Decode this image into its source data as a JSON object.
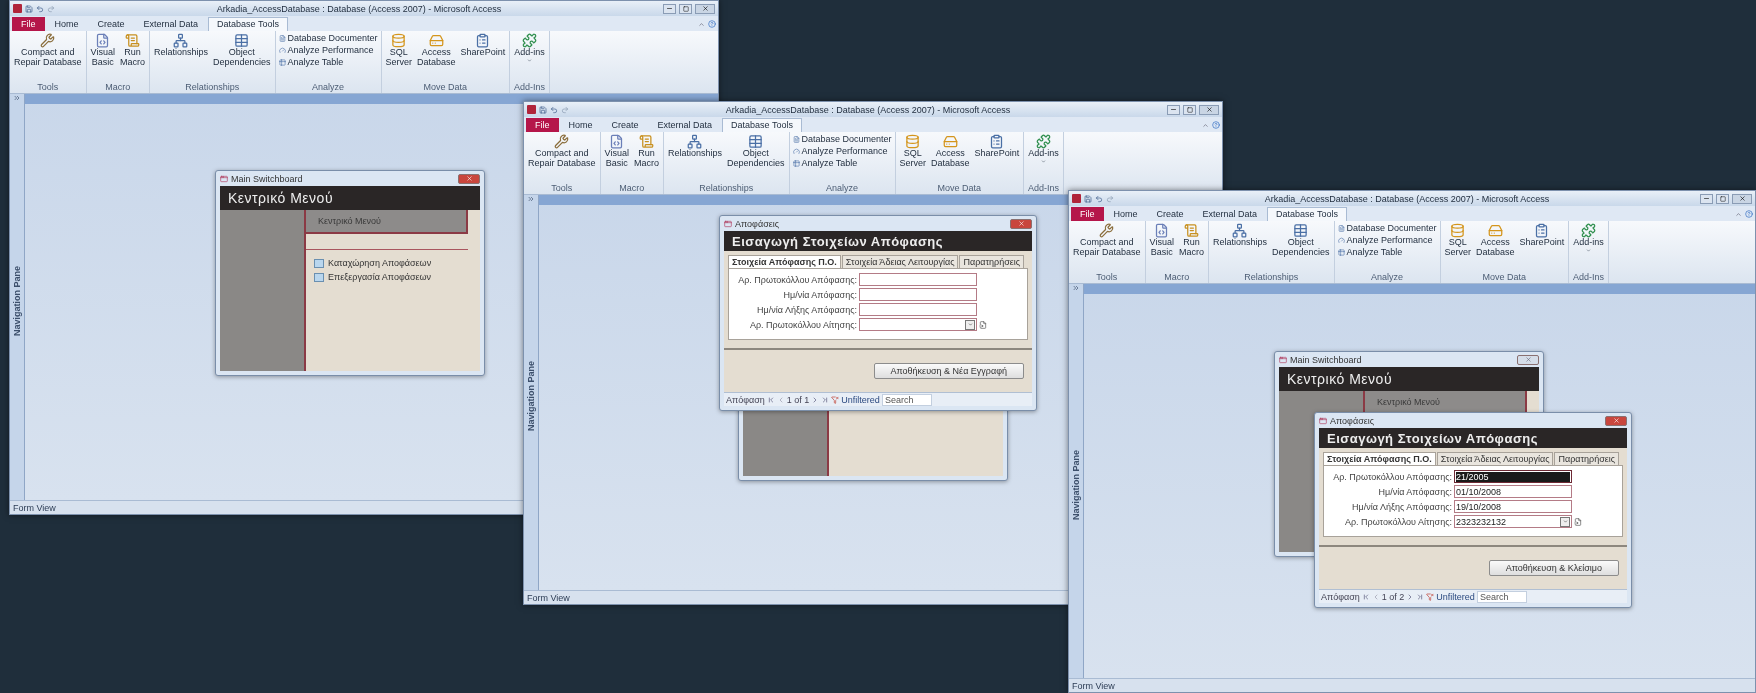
{
  "windows": [
    {
      "title": "Arkadia_AccessDatabase : Database (Access 2007) - Microsoft Access",
      "tabs": [
        {
          "label": "File",
          "kind": "backstage",
          "selected": false
        },
        {
          "label": "Home",
          "kind": "tab",
          "selected": false
        },
        {
          "label": "Create",
          "kind": "tab",
          "selected": false
        },
        {
          "label": "External Data",
          "kind": "tab",
          "selected": false
        },
        {
          "label": "Database Tools",
          "kind": "tab",
          "selected": true
        }
      ],
      "ribbon": [
        {
          "label": "Tools",
          "items": [
            {
              "label": "Compact and\nRepair Database",
              "kind": "large"
            }
          ]
        },
        {
          "label": "Macro",
          "items": [
            {
              "label": "Visual\nBasic",
              "kind": "large"
            },
            {
              "label": "Run\nMacro",
              "kind": "large"
            }
          ]
        },
        {
          "label": "Relationships",
          "items": [
            {
              "label": "Relationships",
              "kind": "large"
            },
            {
              "label": "Object\nDependencies",
              "kind": "large"
            }
          ]
        },
        {
          "label": "Analyze",
          "items": [
            {
              "label": "Database Documenter",
              "kind": "small"
            },
            {
              "label": "Analyze Performance",
              "kind": "small"
            },
            {
              "label": "Analyze Table",
              "kind": "small"
            }
          ]
        },
        {
          "label": "Move Data",
          "items": [
            {
              "label": "SQL\nServer",
              "kind": "large"
            },
            {
              "label": "Access\nDatabase",
              "kind": "large"
            },
            {
              "label": "SharePoint",
              "kind": "large"
            }
          ]
        },
        {
          "label": "Add-Ins",
          "items": [
            {
              "label": "Add-ins",
              "kind": "menu"
            }
          ]
        }
      ],
      "nav_pane": "Navigation Pane",
      "status": "Form View",
      "forms": [
        {
          "kind": "switchboard",
          "title": "Main Switchboard",
          "active": true,
          "heading": "Κεντρικό Μενού",
          "subheading": "Κεντρικό Μενού",
          "items": [
            "Καταχώρηση Αποφάσεων",
            "Επεξεργασία Αποφάσεων"
          ]
        }
      ]
    },
    {
      "title": "Arkadia_AccessDatabase : Database (Access 2007) - Microsoft Access",
      "tabs": [
        {
          "label": "File",
          "kind": "backstage",
          "selected": false
        },
        {
          "label": "Home",
          "kind": "tab",
          "selected": false
        },
        {
          "label": "Create",
          "kind": "tab",
          "selected": false
        },
        {
          "label": "External Data",
          "kind": "tab",
          "selected": false
        },
        {
          "label": "Database Tools",
          "kind": "tab",
          "selected": true
        }
      ],
      "ribbon": [
        {
          "label": "Tools",
          "items": [
            {
              "label": "Compact and\nRepair Database",
              "kind": "large"
            }
          ]
        },
        {
          "label": "Macro",
          "items": [
            {
              "label": "Visual\nBasic",
              "kind": "large"
            },
            {
              "label": "Run\nMacro",
              "kind": "large"
            }
          ]
        },
        {
          "label": "Relationships",
          "items": [
            {
              "label": "Relationships",
              "kind": "large"
            },
            {
              "label": "Object\nDependencies",
              "kind": "large"
            }
          ]
        },
        {
          "label": "Analyze",
          "items": [
            {
              "label": "Database Documenter",
              "kind": "small"
            },
            {
              "label": "Analyze Performance",
              "kind": "small"
            },
            {
              "label": "Analyze Table",
              "kind": "small"
            }
          ]
        },
        {
          "label": "Move Data",
          "items": [
            {
              "label": "SQL\nServer",
              "kind": "large"
            },
            {
              "label": "Access\nDatabase",
              "kind": "large"
            },
            {
              "label": "SharePoint",
              "kind": "large"
            }
          ]
        },
        {
          "label": "Add-Ins",
          "items": [
            {
              "label": "Add-ins",
              "kind": "menu"
            }
          ]
        }
      ],
      "nav_pane": "Navigation Pane",
      "status": "Form View",
      "forms": [
        {
          "kind": "switchboard"
        },
        {
          "kind": "entry",
          "title": "Αποφάσεις",
          "active": true,
          "heading": "Εισαγωγή Στοιχείων Απόφασης",
          "tabs": [
            {
              "label": "Στοιχεία Απόφασης Π.Ο.",
              "selected": true
            },
            {
              "label": "Στοιχεία Άδειας Λειτουργίας",
              "selected": false
            },
            {
              "label": "Παρατηρήσεις",
              "selected": false
            }
          ],
          "fields": [
            {
              "label": "Αρ. Πρωτοκόλλου Απόφασης:",
              "kind": "text",
              "selected": false
            },
            {
              "label": "Ημ/νία Απόφασης:",
              "kind": "text",
              "selected": false
            },
            {
              "label": "Ημ/νία Λήξης Απόφασης:",
              "kind": "text",
              "selected": false
            },
            {
              "label": "Αρ. Πρωτοκόλλου Αίτησης:",
              "kind": "combo",
              "selected": false
            }
          ],
          "button": "Αποθήκευση & Νέα Εγγραφή",
          "record_nav": {
            "label": "Απόφαση",
            "position": "1 of 1",
            "filter": "Unfiltered",
            "placeholder": "Search"
          }
        }
      ]
    },
    {
      "title": "Arkadia_AccessDatabase : Database (Access 2007) - Microsoft Access",
      "tabs": [
        {
          "label": "File",
          "kind": "backstage",
          "selected": false
        },
        {
          "label": "Home",
          "kind": "tab",
          "selected": false
        },
        {
          "label": "Create",
          "kind": "tab",
          "selected": false
        },
        {
          "label": "External Data",
          "kind": "tab",
          "selected": false
        },
        {
          "label": "Database Tools",
          "kind": "tab",
          "selected": true
        }
      ],
      "ribbon": [
        {
          "label": "Tools",
          "items": [
            {
              "label": "Compact and\nRepair Database",
              "kind": "large"
            }
          ]
        },
        {
          "label": "Macro",
          "items": [
            {
              "label": "Visual\nBasic",
              "kind": "large"
            },
            {
              "label": "Run\nMacro",
              "kind": "large"
            }
          ]
        },
        {
          "label": "Relationships",
          "items": [
            {
              "label": "Relationships",
              "kind": "large"
            },
            {
              "label": "Object\nDependencies",
              "kind": "large"
            }
          ]
        },
        {
          "label": "Analyze",
          "items": [
            {
              "label": "Database Documenter",
              "kind": "small"
            },
            {
              "label": "Analyze Performance",
              "kind": "small"
            },
            {
              "label": "Analyze Table",
              "kind": "small"
            }
          ]
        },
        {
          "label": "Move Data",
          "items": [
            {
              "label": "SQL\nServer",
              "kind": "large"
            },
            {
              "label": "Access\nDatabase",
              "kind": "large"
            },
            {
              "label": "SharePoint",
              "kind": "large"
            }
          ]
        },
        {
          "label": "Add-Ins",
          "items": [
            {
              "label": "Add-ins",
              "kind": "menu"
            }
          ]
        }
      ],
      "nav_pane": "Navigation Pane",
      "status": "Form View",
      "forms": [
        {
          "kind": "switchboard",
          "title": "Main Switchboard",
          "active": false,
          "heading": "Κεντρικό Μενού",
          "subheading": "Κεντρικό Μενού"
        },
        {
          "kind": "entry",
          "title": "Αποφάσεις",
          "active": true,
          "heading": "Εισαγωγή Στοιχείων Απόφασης",
          "tabs": [
            {
              "label": "Στοιχεία Απόφασης Π.Ο.",
              "selected": true
            },
            {
              "label": "Στοιχεία Άδειας Λειτουργίας",
              "selected": false
            },
            {
              "label": "Παρατηρήσεις",
              "selected": false
            }
          ],
          "fields": [
            {
              "label": "Αρ. Πρωτοκόλλου Απόφασης:",
              "kind": "text",
              "value": "21/2005",
              "selected": true
            },
            {
              "label": "Ημ/νία Απόφασης:",
              "kind": "text",
              "value": "01/10/2008",
              "selected": false
            },
            {
              "label": "Ημ/νία Λήξης Απόφασης:",
              "kind": "text",
              "value": "19/10/2008",
              "selected": false
            },
            {
              "label": "Αρ. Πρωτοκόλλου Αίτησης:",
              "kind": "combo",
              "value": "2323232132",
              "selected": false
            }
          ],
          "button": "Αποθήκευση & Κλείσιμο",
          "record_nav": {
            "label": "Απόφαση",
            "position": "1 of 2",
            "filter": "Unfiltered",
            "placeholder": "Search"
          }
        }
      ]
    }
  ]
}
